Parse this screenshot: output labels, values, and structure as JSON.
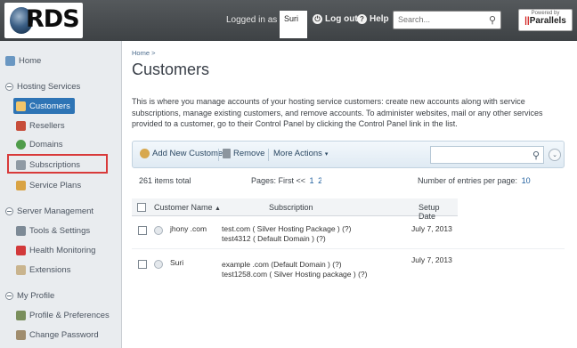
{
  "header": {
    "logo_text": "RDS",
    "logged_in_label": "Logged in as",
    "username": "Suri",
    "logout_label": "Log out",
    "help_label": "Help",
    "search_placeholder": "Search...",
    "powered_by": "Powered by",
    "parallels_label": "Parallels"
  },
  "sidebar": {
    "home": "Home",
    "sections": [
      {
        "title": "Hosting Services",
        "items": [
          "Customers",
          "Resellers",
          "Domains",
          "Subscriptions",
          "Service Plans"
        ]
      },
      {
        "title": "Server Management",
        "items": [
          "Tools & Settings",
          "Health Monitoring",
          "Extensions"
        ]
      },
      {
        "title": "My Profile",
        "items": [
          "Profile & Preferences",
          "Change Password"
        ]
      }
    ],
    "active_item": "Customers",
    "highlighted_item": "Subscriptions"
  },
  "main": {
    "breadcrumb": "Home >",
    "title": "Customers",
    "intro": "This is where you manage accounts of your hosting service customers: create new accounts along with service subscriptions, manage existing customers, and remove accounts. To administer websites, mail or any other services provided to a customer, go to their Control Panel by clicking the Control Panel link in the list.",
    "toolbar": {
      "add_label": "Add New Customer",
      "remove_label": "Remove",
      "more_label": "More Actions"
    },
    "items_total": "261 items total",
    "pages": {
      "label": "Pages: First <<",
      "links": [
        "1",
        "2",
        "3"
      ]
    },
    "entries": {
      "label": "Number of entries per page:",
      "value": "10"
    },
    "table": {
      "columns": [
        "Customer Name",
        "Subscription",
        "Setup Date"
      ],
      "rows": [
        {
          "name": "jhony .com",
          "subs": [
            "test.com ( Silver Hosting Package ) (?)",
            "test4312 ( Default Domain ) (?)"
          ],
          "date": "July 7, 2013"
        },
        {
          "name": "Suri",
          "subs": [
            "example .com (Default Domain ) (?)",
            "test1258.com ( Silver Hosting package ) (?)"
          ],
          "date": "July 7, 2013"
        }
      ]
    }
  },
  "colors": {
    "accent": "#2e74b5",
    "highlight": "#d83a3a",
    "topbar": "#46494c"
  }
}
